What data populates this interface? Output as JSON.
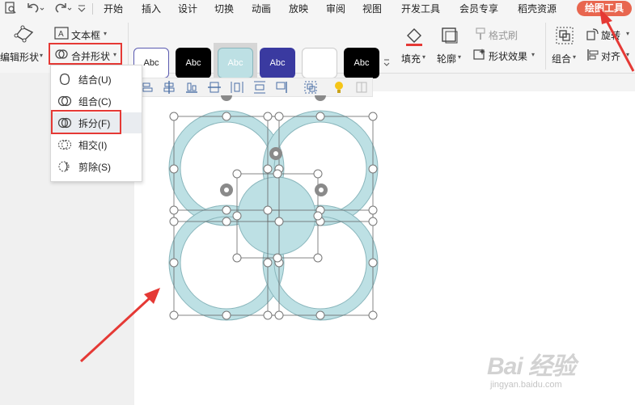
{
  "menu": {
    "items": [
      "开始",
      "插入",
      "设计",
      "切换",
      "动画",
      "放映",
      "审阅",
      "视图",
      "开发工具",
      "会员专享",
      "稻壳资源"
    ],
    "active_tab": "绘图工具"
  },
  "ribbon": {
    "edit_shape": "编辑形状",
    "text_box": "文本框",
    "merge_shapes": "合并形状",
    "style_swatch_text": "Abc",
    "fill": "填充",
    "outline": "轮廓",
    "format_painter": "格式刷",
    "shape_effects": "形状效果",
    "group": "组合",
    "rotate": "旋转",
    "align": "对齐"
  },
  "merge_menu": {
    "items": [
      {
        "label": "结合(U)",
        "icon": "union-icon"
      },
      {
        "label": "组合(C)",
        "icon": "combine-icon"
      },
      {
        "label": "拆分(F)",
        "icon": "fragment-icon",
        "highlighted": true
      },
      {
        "label": "相交(I)",
        "icon": "intersect-icon"
      },
      {
        "label": "剪除(S)",
        "icon": "subtract-icon"
      }
    ]
  },
  "colors": {
    "accent": "#e8664f",
    "highlight_box": "#e53935",
    "shape_fill": "#bde0e4",
    "shape_stroke": "#8ab6bc",
    "swatch_navy": "#3a3aa0"
  },
  "watermark": {
    "brand": "Bai 经验",
    "url": "jingyan.baidu.com"
  }
}
